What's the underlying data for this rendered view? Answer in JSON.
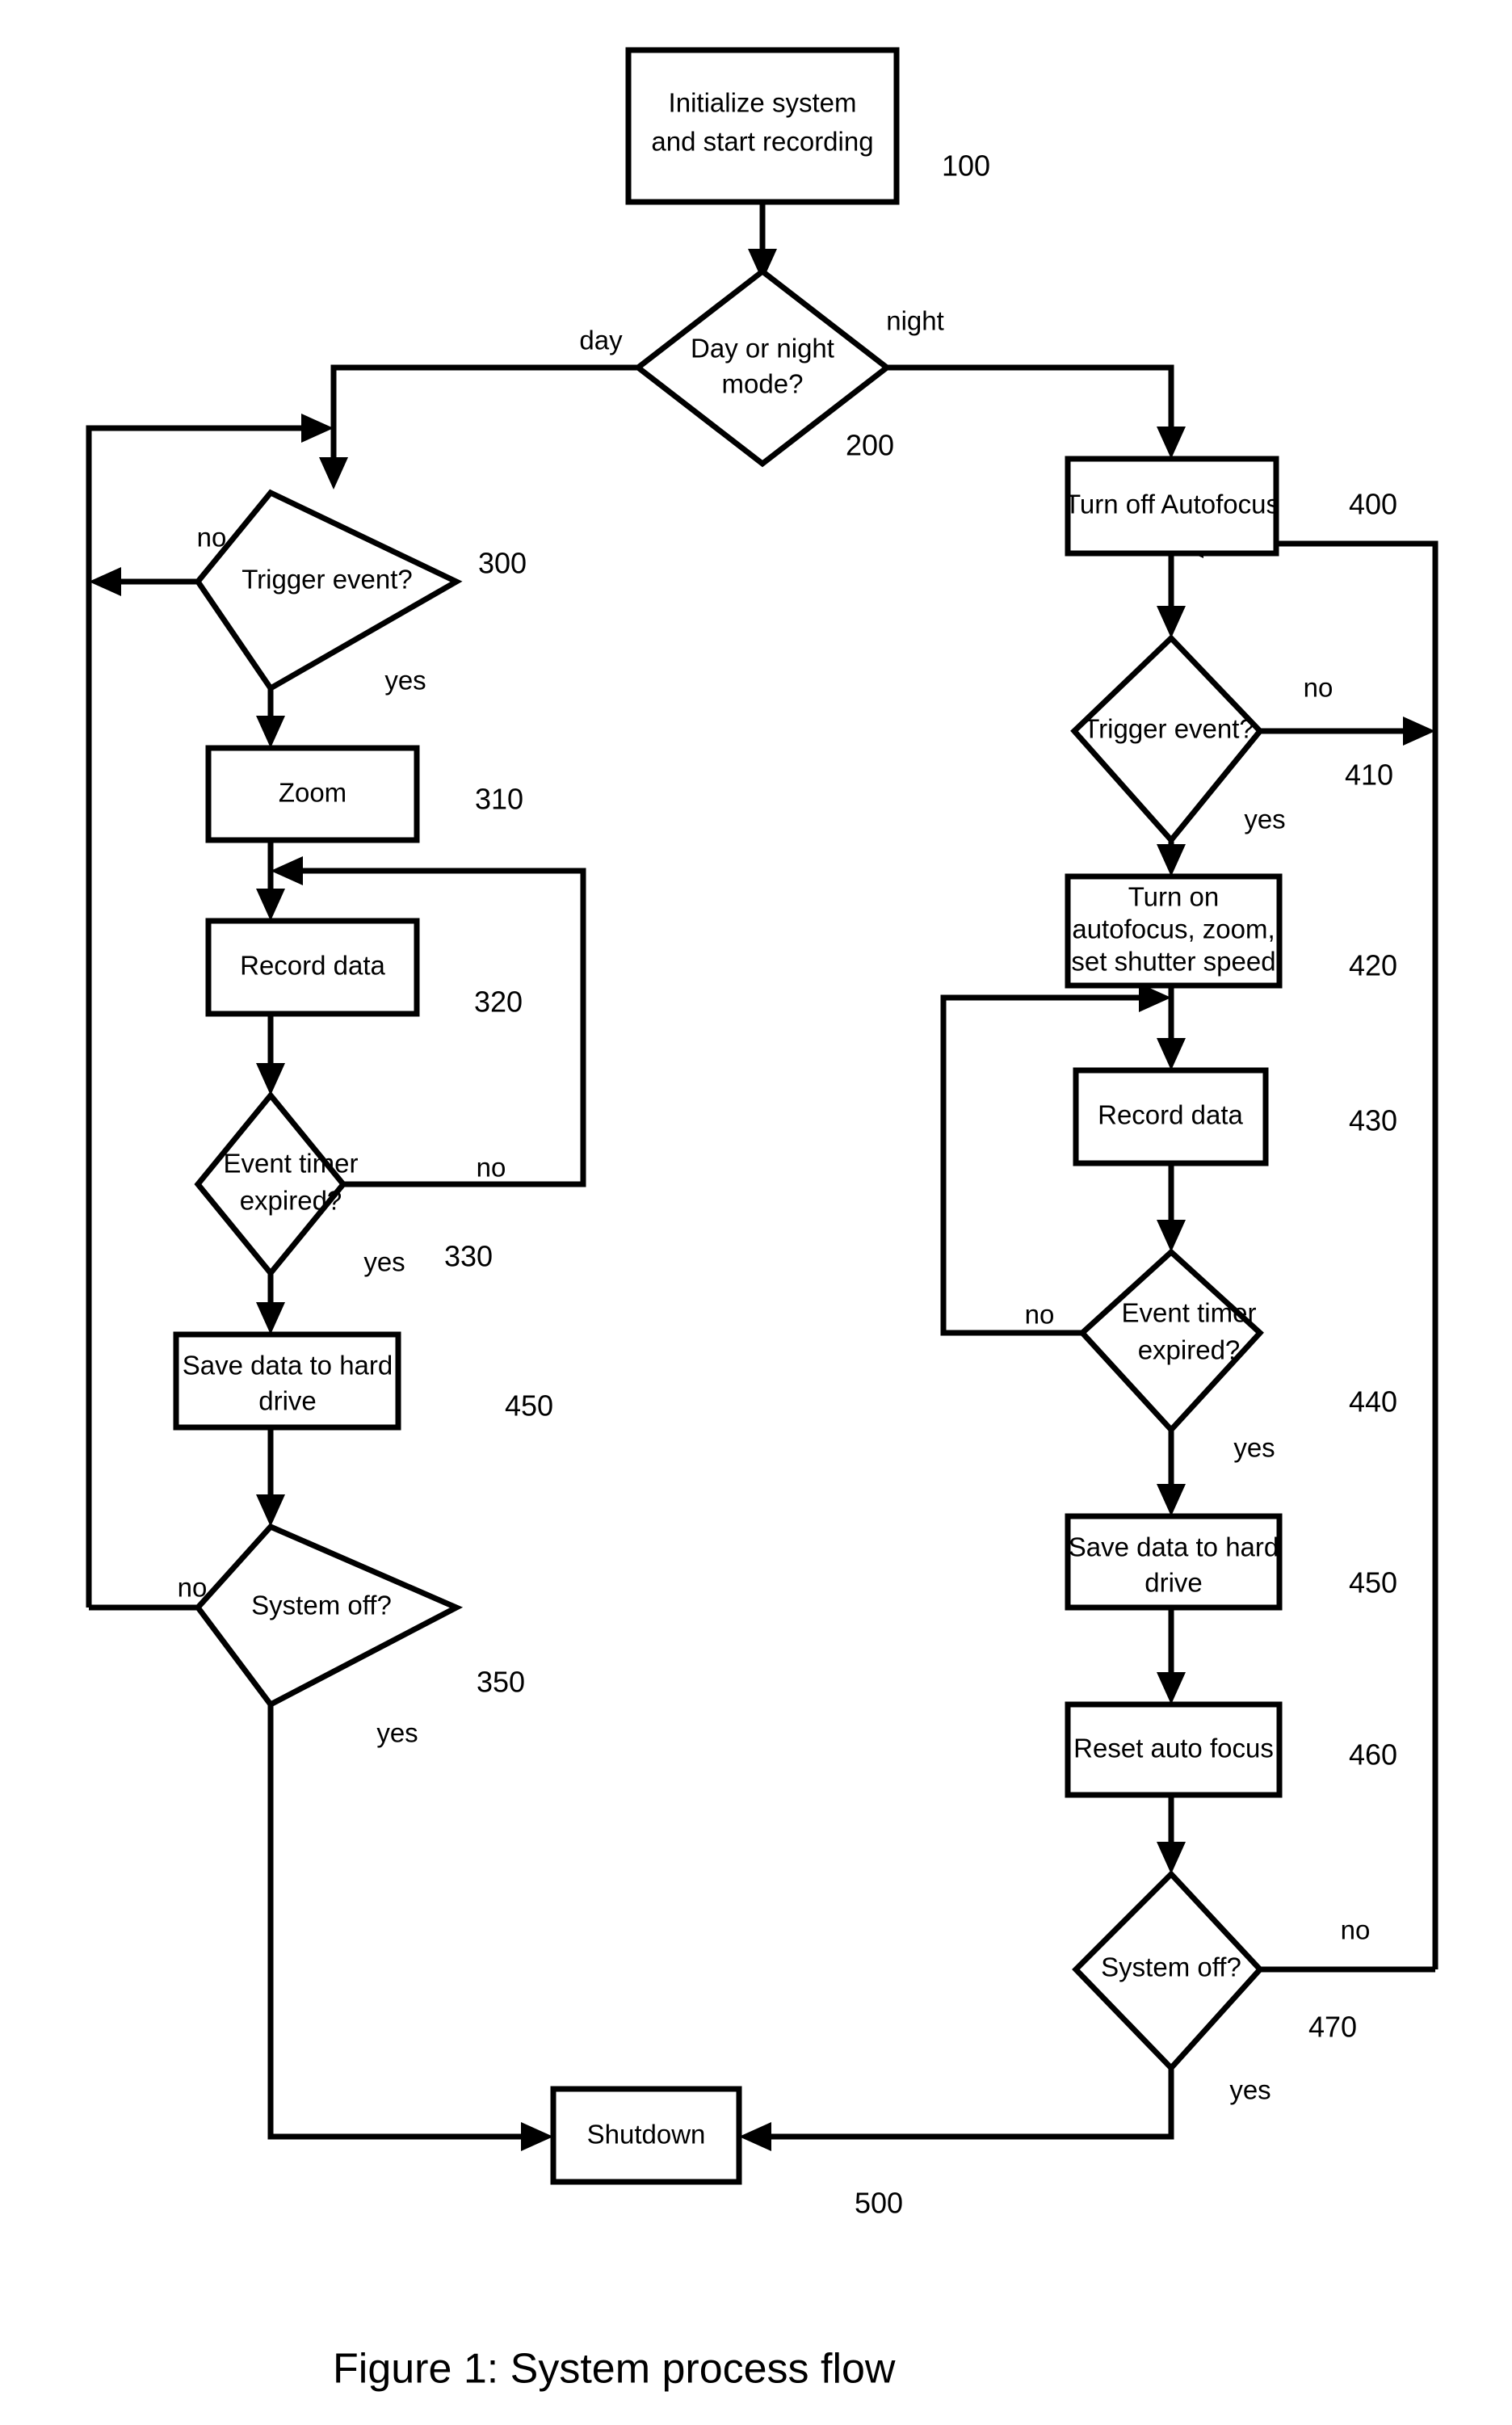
{
  "figure": {
    "caption": "Figure 1: System process flow"
  },
  "nodes": {
    "init": {
      "ref": "100",
      "lines": [
        "Initialize system",
        "and start recording"
      ]
    },
    "daynight": {
      "ref": "200",
      "lines": [
        "Day or night",
        "mode?"
      ]
    },
    "trigger_day": {
      "ref": "300",
      "lines": [
        "Trigger event?"
      ]
    },
    "zoom": {
      "ref": "310",
      "lines": [
        "Zoom"
      ]
    },
    "record_day": {
      "ref": "320",
      "lines": [
        "Record data"
      ]
    },
    "timer_day": {
      "ref": "330",
      "lines": [
        "Event timer",
        "expired?"
      ]
    },
    "save_day": {
      "ref": "450",
      "lines": [
        "Save data to hard",
        "drive"
      ]
    },
    "sysoff_day": {
      "ref": "350",
      "lines": [
        "System off?"
      ]
    },
    "autofocus_off": {
      "ref": "400",
      "lines": [
        "Turn off Autofocus"
      ]
    },
    "trigger_night": {
      "ref": "410",
      "lines": [
        "Trigger event?"
      ]
    },
    "turn_on": {
      "ref": "420",
      "lines": [
        "Turn on",
        "autofocus, zoom,",
        "set shutter speed"
      ]
    },
    "record_night": {
      "ref": "430",
      "lines": [
        "Record data"
      ]
    },
    "timer_night": {
      "ref": "440",
      "lines": [
        "Event timer",
        "expired?"
      ]
    },
    "save_night": {
      "ref": "450",
      "lines": [
        "Save data to hard",
        "drive"
      ]
    },
    "reset_af": {
      "ref": "460",
      "lines": [
        "Reset auto focus"
      ]
    },
    "sysoff_night": {
      "ref": "470",
      "lines": [
        "System off?"
      ]
    },
    "shutdown": {
      "ref": "500",
      "lines": [
        "Shutdown"
      ]
    }
  },
  "edge_labels": {
    "day": "day",
    "night": "night",
    "trigger_day_no": "no",
    "trigger_day_yes": "yes",
    "timer_day_no": "no",
    "timer_day_yes": "yes",
    "sysoff_day_no": "no",
    "sysoff_day_yes": "yes",
    "trigger_night_no": "no",
    "trigger_night_yes": "yes",
    "timer_night_no": "no",
    "timer_night_yes": "yes",
    "sysoff_night_no": "no",
    "sysoff_night_yes": "yes"
  },
  "colors": {
    "stroke": "#000000",
    "fill": "#ffffff",
    "background": "#ffffff"
  },
  "chart_data": {
    "type": "table",
    "title": "Figure 1: System process flow",
    "categories": [
      "100 Initialize system and start recording",
      "200 Day or night mode?",
      "300 Trigger event?",
      "310 Zoom",
      "320 Record data",
      "330 Event timer expired?",
      "450 Save data to hard drive",
      "350 System off?",
      "400 Turn off Autofocus",
      "410 Trigger event?",
      "420 Turn on autofocus, zoom, set shutter speed",
      "430 Record data",
      "440 Event timer expired?",
      "450 Save data to hard drive",
      "460 Reset auto focus",
      "470 System off?",
      "500 Shutdown"
    ]
  }
}
